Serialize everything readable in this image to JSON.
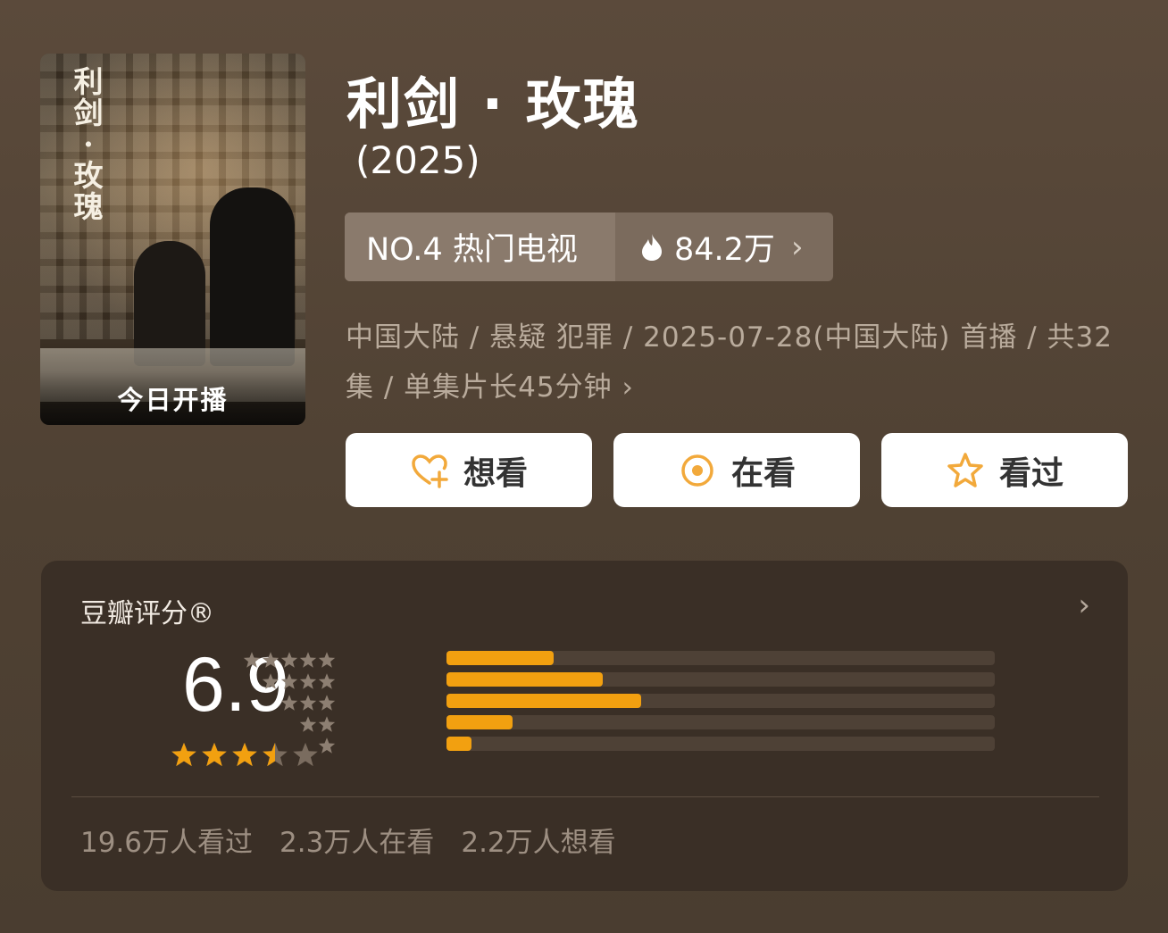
{
  "poster": {
    "title_vertical": "利剑·玫瑰",
    "badge": "今日开播"
  },
  "header": {
    "title": "利剑 · 玫瑰",
    "year": "(2025)"
  },
  "ranking": {
    "rank_label": "NO.4 热门电视",
    "heat_value": "84.2万",
    "heat_icon": "flame-icon"
  },
  "meta": {
    "text": "中国大陆 / 悬疑 犯罪 / 2025-07-28(中国大陆) 首播 / 共32集 / 单集片长45分钟"
  },
  "actions": [
    {
      "label": "想看",
      "icon": "heart-plus-icon",
      "color": "#f2a93b"
    },
    {
      "label": "在看",
      "icon": "target-icon",
      "color": "#f2a93b"
    },
    {
      "label": "看过",
      "icon": "star-outline-icon",
      "color": "#f2a93b"
    }
  ],
  "rating": {
    "label": "豆瓣评分®",
    "score": "6.9",
    "stars_filled": 3.5,
    "stars_total": 5,
    "distribution": [
      {
        "stars": 5,
        "fraction": 0.195
      },
      {
        "stars": 4,
        "fraction": 0.285
      },
      {
        "stars": 3,
        "fraction": 0.355
      },
      {
        "stars": 2,
        "fraction": 0.12
      },
      {
        "stars": 1,
        "fraction": 0.045
      }
    ],
    "stats": [
      "19.6万人看过",
      "2.3万人在看",
      "2.2万人想看"
    ]
  },
  "colors": {
    "accent": "#f2a010",
    "background": "#554536",
    "card": "#3a2f26"
  }
}
